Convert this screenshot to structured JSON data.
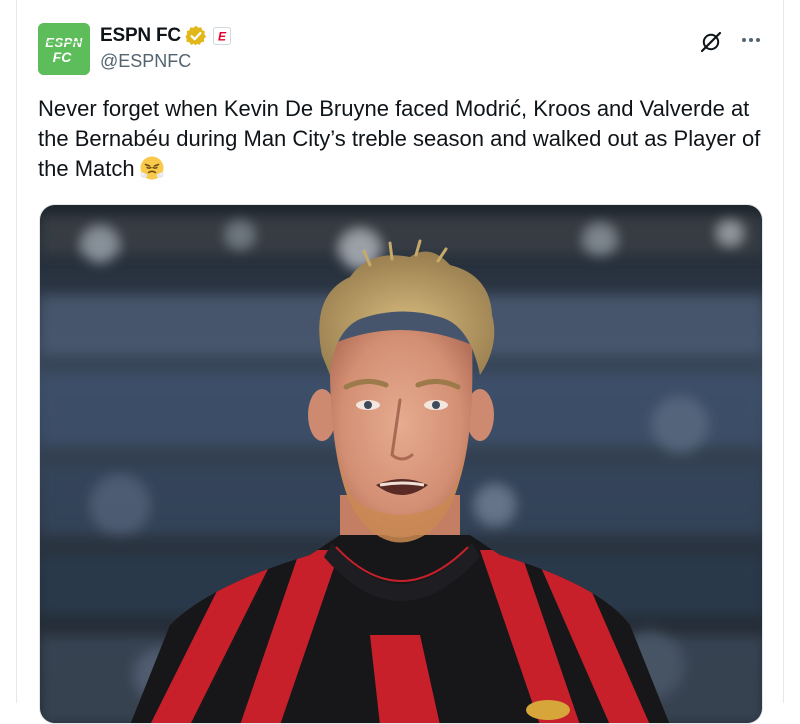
{
  "tweet": {
    "author": {
      "display_name": "ESPN FC",
      "handle": "@ESPNFC",
      "avatar_icon": "espn-fc-logo",
      "avatar_color": "#5cbd5a",
      "avatar_text_top": "ESPN",
      "avatar_text_bottom": "FC",
      "verified_icon": "gold-verified-badge",
      "verified_color": "#e2b719",
      "affiliate_icon": "espn-affiliate-badge",
      "affiliate_letter": "E",
      "affiliate_color": "#e4002b"
    },
    "text": "Never forget when Kevin De Bruyne faced Modrić, Kroos and Valverde at the Bernabéu during Man City’s treble season and walked out as Player of the Match",
    "emoji_icon": "steam-from-nose-face-emoji",
    "actions": {
      "grok_icon": "grok-icon",
      "more_icon": "more-options-icon"
    },
    "media": {
      "type": "photo",
      "subject_icon": "player-photo",
      "colors": {
        "background": "#2f3a48",
        "kit_red": "#c8202b",
        "kit_black": "#17171a",
        "hair": "#b89a5f",
        "skin": "#d99a7e"
      }
    }
  }
}
